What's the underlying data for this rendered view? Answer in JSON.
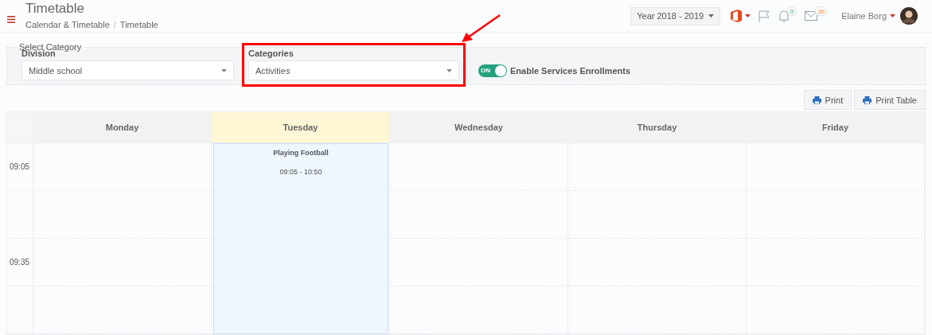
{
  "header": {
    "title": "Timetable",
    "breadcrumb": [
      "Calendar & Timetable",
      "Timetable"
    ],
    "separator": "/",
    "year": "Year 2018 - 2019",
    "notifications": "0",
    "messages": "36",
    "user": "Elaine Borg"
  },
  "filters": {
    "legend": "Select Category",
    "fields": [
      {
        "label": "Division",
        "value": "Middle school",
        "highlighted": false
      },
      {
        "label": "Categories",
        "value": "Activities",
        "highlighted": true
      }
    ],
    "toggle": {
      "on": true,
      "on_text": "ON",
      "label": "Enable Services Enrollments"
    }
  },
  "actions": [
    "Print",
    "Print Table"
  ],
  "table": {
    "days": [
      {
        "label": "Monday",
        "selected": false
      },
      {
        "label": "Tuesday",
        "selected": true,
        "events": [
          {
            "title": "Playing Football",
            "time": "09:05 - 10:50"
          }
        ]
      },
      {
        "label": "Wednesday",
        "selected": false
      },
      {
        "label": "Thursday",
        "selected": false
      },
      {
        "label": "Friday",
        "selected": false
      }
    ],
    "times": [
      "09:05",
      "09:35"
    ]
  }
}
